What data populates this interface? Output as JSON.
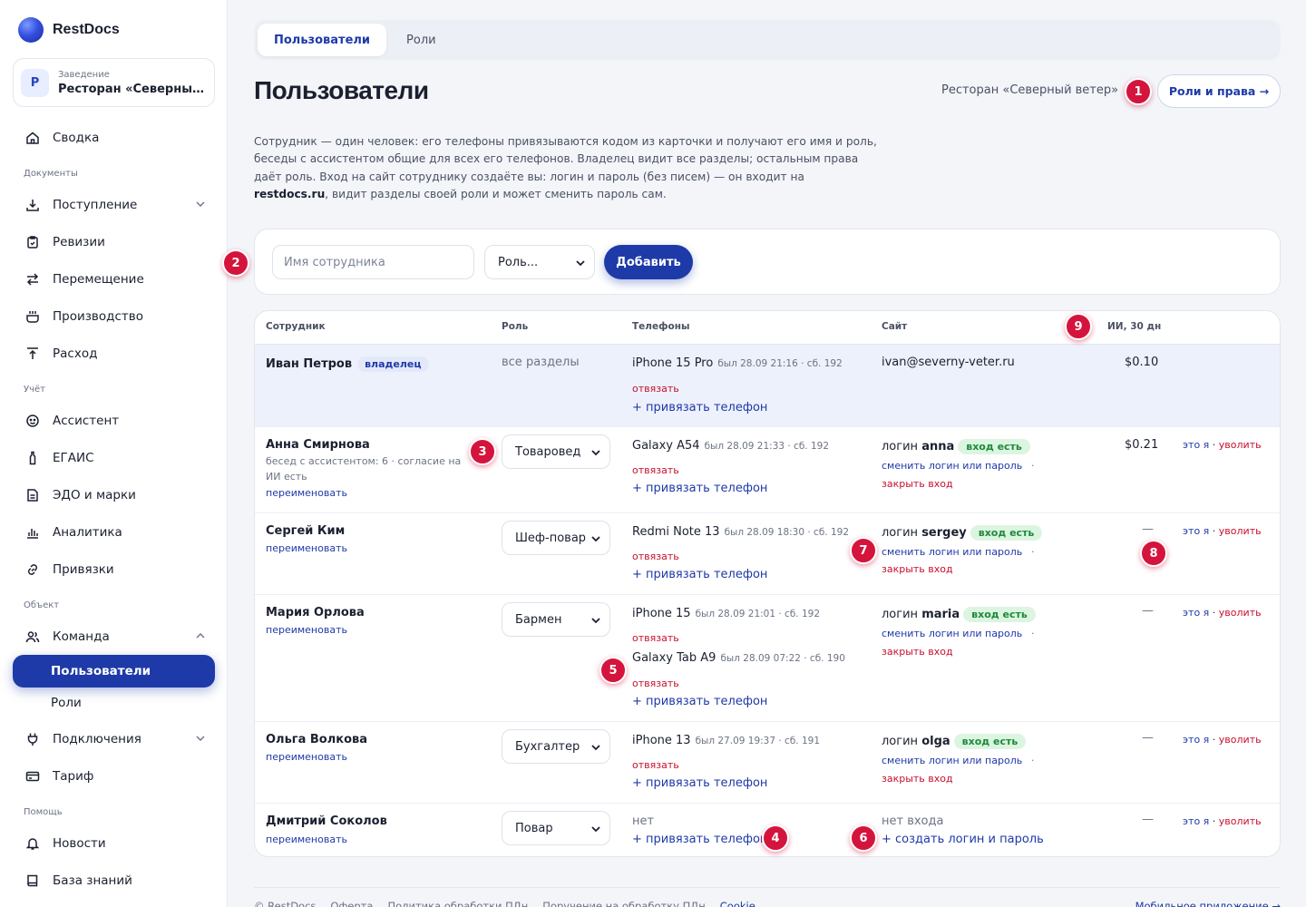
{
  "app": {
    "name": "RestDocs"
  },
  "venue": {
    "avatar": "Р",
    "label": "Заведение",
    "name": "Ресторан «Северный ..."
  },
  "sidebar": {
    "summary": "Сводка",
    "sections": {
      "docs": "Документы",
      "accounting": "Учёт",
      "object": "Объект",
      "help": "Помощь"
    },
    "items": {
      "incoming": "Поступление",
      "revisions": "Ревизии",
      "transfer": "Перемещение",
      "production": "Производство",
      "expense": "Расход",
      "assistant": "Ассистент",
      "egais": "ЕГАИС",
      "edo": "ЭДО и марки",
      "analytics": "Аналитика",
      "bindings": "Привязки",
      "team": "Команда",
      "users": "Пользователи",
      "roles": "Роли",
      "connections": "Подключения",
      "tariff": "Тариф",
      "news": "Новости",
      "kb": "База знаний"
    },
    "icons": [
      "home-icon",
      "download-icon",
      "clipboard-icon",
      "swap-icon",
      "pot-icon",
      "upload-icon",
      "assistant-icon",
      "bottle-icon",
      "document-icon",
      "bar-chart-icon",
      "link-icon",
      "team-icon",
      "plug-icon",
      "card-icon",
      "bell-icon",
      "book-icon"
    ]
  },
  "tabs": [
    "Пользователи",
    "Роли"
  ],
  "header": {
    "title": "Пользователи",
    "venue": "Ресторан «Северный ветер»",
    "roles_button": "Роли и права →"
  },
  "intro": {
    "part1": "Сотрудник — один человек: его телефоны привязываются кодом из карточки и получают его имя и роль, беседы с ассистентом общие для всех его телефонов. Владелец видит все разделы; остальным права даёт роль. Вход на сайт сотруднику создаёте вы: логин и пароль (без писем) — он входит на ",
    "site": "restdocs.ru",
    "part2": ", видит разделы своей роли и может сменить пароль сам."
  },
  "add_form": {
    "name_placeholder": "Имя сотрудника",
    "role_placeholder": "Роль...",
    "add_button": "Добавить"
  },
  "table": {
    "headers": [
      "Сотрудник",
      "Роль",
      "Телефоны",
      "Сайт",
      "ИИ, 30 дн"
    ],
    "owner": {
      "name": "Иван Петров",
      "badge": "владелец",
      "role": "все разделы",
      "phone": "iPhone 15 Pro",
      "phone_meta": "был 28.09 21:16 · сб. 192",
      "unbind": "отвязать",
      "bind": "+ привязать телефон",
      "site": "ivan@severny-veter.ru",
      "ai": "$0.10"
    },
    "rows": [
      {
        "name": "Анна Смирнова",
        "sub": "бесед с ассистентом: 6 · согласие на ИИ есть",
        "rename": "переименовать",
        "role": "Товаровед",
        "phones": [
          {
            "model": "Galaxy A54",
            "meta": "был 28.09 21:33 · сб. 192"
          }
        ],
        "login_prefix": "логин",
        "login": "anna",
        "status": "вход есть",
        "change": "сменить логин или пароль",
        "close": "закрыть вход",
        "ai": "$0.21"
      },
      {
        "name": "Сергей Ким",
        "rename": "переименовать",
        "role": "Шеф-повар",
        "phones": [
          {
            "model": "Redmi Note 13",
            "meta": "был 28.09 18:30 · сб. 192"
          }
        ],
        "login_prefix": "логин",
        "login": "sergey",
        "status": "вход есть",
        "change": "сменить логин или пароль",
        "close": "закрыть вход",
        "ai": "—"
      },
      {
        "name": "Мария Орлова",
        "rename": "переименовать",
        "role": "Бармен",
        "phones": [
          {
            "model": "iPhone 15",
            "meta": "был 28.09 21:01 · сб. 192"
          },
          {
            "model": "Galaxy Tab A9",
            "meta": "был 28.09 07:22 · сб. 190"
          }
        ],
        "login_prefix": "логин",
        "login": "maria",
        "status": "вход есть",
        "change": "сменить логин или пароль",
        "close": "закрыть вход",
        "ai": "—"
      },
      {
        "name": "Ольга Волкова",
        "rename": "переименовать",
        "role": "Бухгалтер",
        "phones": [
          {
            "model": "iPhone 13",
            "meta": "был 27.09 19:37 · сб. 191"
          }
        ],
        "login_prefix": "логин",
        "login": "olga",
        "status": "вход есть",
        "change": "сменить логин или пароль",
        "close": "закрыть вход",
        "ai": "—"
      },
      {
        "name": "Дмитрий Соколов",
        "rename": "переименовать",
        "role": "Повар",
        "no_phone": "нет",
        "no_login": "нет входа",
        "create_login": "+ создать логин и пароль",
        "ai": "—"
      }
    ],
    "unbind": "отвязать",
    "bind": "+ привязать телефон",
    "dot": " · ",
    "this_me": "это я",
    "fire": "уволить"
  },
  "callouts": [
    "1",
    "2",
    "3",
    "4",
    "5",
    "6",
    "7",
    "8",
    "9"
  ],
  "footer": {
    "copyright": "© RestDocs",
    "offer": "Оферта",
    "policy": "Политика обработки ПДн",
    "consent": "Поручение на обработку ПДн",
    "cookie": "Cookie",
    "mobile": "Мобильное приложение →"
  },
  "colors": {
    "accent": "#1e3aa8",
    "danger": "#c8102e",
    "callout": "#d4143c",
    "success_bg": "#dcf5e1",
    "success_text": "#1e8a3a"
  }
}
